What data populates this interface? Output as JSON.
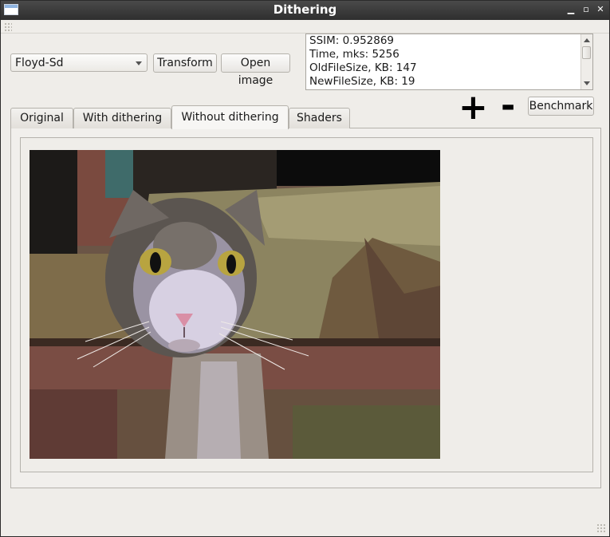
{
  "window": {
    "title": "Dithering"
  },
  "toolbar": {
    "algorithm_value": "Floyd-Sd",
    "transform_label": "Transform",
    "open_image_label": "Open image",
    "benchmark_label": "Benchmark",
    "zoom_in_label": "+",
    "zoom_out_label": "-"
  },
  "stats": {
    "lines": [
      "SSIM: 0.952869",
      "Time, mks: 5256",
      "OldFileSize, KB: 147",
      "NewFileSize, KB: 19"
    ]
  },
  "tabs": [
    {
      "label": "Original",
      "active": false
    },
    {
      "label": "With dithering",
      "active": false
    },
    {
      "label": "Without dithering",
      "active": true
    },
    {
      "label": "Shaders",
      "active": false
    }
  ],
  "colors": {
    "titlebar": "#3a3a3a",
    "window_bg": "#efede9",
    "panel_border": "#b5b2ac"
  },
  "icons": {
    "app": "window-app-icon",
    "minimize": "minimize-icon",
    "maximize": "maximize-icon",
    "close": "close-icon",
    "dropdown": "chevron-down-icon"
  }
}
